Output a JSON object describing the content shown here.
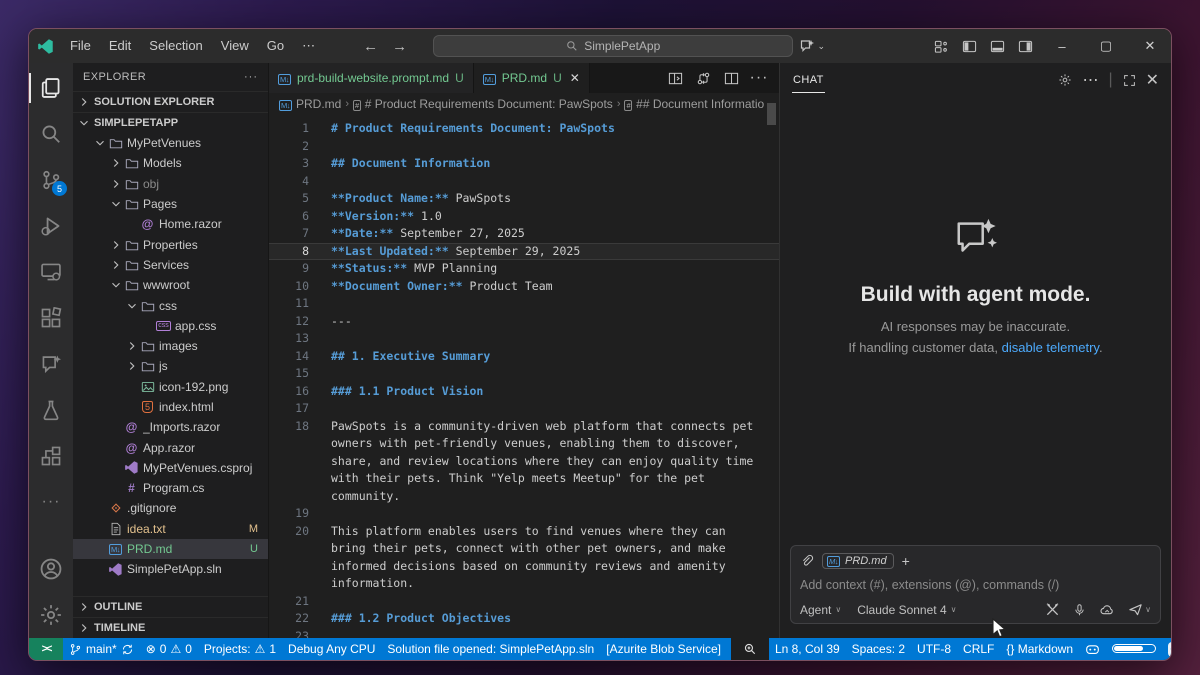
{
  "colors": {
    "statusbar_blue": "#0078d4",
    "remote_green": "#16825d",
    "untracked_green": "#73c991",
    "modified_yellow": "#e2c08d",
    "link_blue": "#4daafc",
    "heading_blue": "#569cd6"
  },
  "titlebar": {
    "menus": [
      "File",
      "Edit",
      "Selection",
      "View",
      "Go",
      "⋯"
    ],
    "search_text": "SimplePetApp"
  },
  "activity_bar": {
    "top": [
      {
        "name": "explorer",
        "active": true
      },
      {
        "name": "search"
      },
      {
        "name": "source-control",
        "badge": "5"
      },
      {
        "name": "run-debug"
      },
      {
        "name": "remote-explorer"
      },
      {
        "name": "extensions"
      },
      {
        "name": "copilot-edits"
      },
      {
        "name": "testing"
      },
      {
        "name": "solution-explorer"
      },
      {
        "name": "more"
      }
    ],
    "bottom": [
      {
        "name": "account"
      },
      {
        "name": "settings"
      }
    ]
  },
  "sidebar": {
    "title": "EXPLORER",
    "tree": [
      {
        "kind": "section",
        "chevron": "right",
        "label": "SOLUTION EXPLORER"
      },
      {
        "kind": "section",
        "chevron": "down",
        "label": "SIMPLEPETAPP"
      },
      {
        "kind": "item",
        "depth": 1,
        "chevron": "down",
        "icon": "folder",
        "label": "MyPetVenues"
      },
      {
        "kind": "item",
        "depth": 2,
        "chevron": "right",
        "icon": "folder",
        "label": "Models"
      },
      {
        "kind": "item",
        "depth": 2,
        "chevron": "right",
        "icon": "folder",
        "label": "obj",
        "dim": true
      },
      {
        "kind": "item",
        "depth": 2,
        "chevron": "down",
        "icon": "folder",
        "label": "Pages"
      },
      {
        "kind": "item",
        "depth": 3,
        "icon": "razor",
        "label": "Home.razor"
      },
      {
        "kind": "item",
        "depth": 2,
        "chevron": "right",
        "icon": "folder",
        "label": "Properties"
      },
      {
        "kind": "item",
        "depth": 2,
        "chevron": "right",
        "icon": "folder",
        "label": "Services"
      },
      {
        "kind": "item",
        "depth": 2,
        "chevron": "down",
        "icon": "folder",
        "label": "wwwroot"
      },
      {
        "kind": "item",
        "depth": 3,
        "chevron": "down",
        "icon": "folder",
        "label": "css"
      },
      {
        "kind": "item",
        "depth": 4,
        "icon": "css",
        "label": "app.css"
      },
      {
        "kind": "item",
        "depth": 3,
        "chevron": "right",
        "icon": "folder",
        "label": "images"
      },
      {
        "kind": "item",
        "depth": 3,
        "chevron": "right",
        "icon": "folder",
        "label": "js"
      },
      {
        "kind": "item",
        "depth": 3,
        "icon": "image",
        "label": "icon-192.png"
      },
      {
        "kind": "item",
        "depth": 3,
        "icon": "html",
        "label": "index.html"
      },
      {
        "kind": "item",
        "depth": 2,
        "icon": "razor",
        "label": "_Imports.razor"
      },
      {
        "kind": "item",
        "depth": 2,
        "icon": "razor",
        "label": "App.razor"
      },
      {
        "kind": "item",
        "depth": 2,
        "icon": "vs",
        "label": "MyPetVenues.csproj"
      },
      {
        "kind": "item",
        "depth": 2,
        "icon": "cs",
        "label": "Program.cs"
      },
      {
        "kind": "item",
        "depth": 1,
        "icon": "git",
        "label": ".gitignore"
      },
      {
        "kind": "item",
        "depth": 1,
        "icon": "txt",
        "label": "idea.txt",
        "color": "modified",
        "badge": "M"
      },
      {
        "kind": "item",
        "depth": 1,
        "icon": "md",
        "label": "PRD.md",
        "color": "untracked",
        "badge": "U",
        "selected": true
      },
      {
        "kind": "item",
        "depth": 1,
        "icon": "vs",
        "label": "SimplePetApp.sln"
      }
    ],
    "bottom_sections": [
      "OUTLINE",
      "TIMELINE"
    ]
  },
  "editor": {
    "tabs": [
      {
        "label": "prd-build-website.prompt.md",
        "badge": "U",
        "icon": "md",
        "active": false
      },
      {
        "label": "PRD.md",
        "badge": "U",
        "icon": "md",
        "active": true,
        "close": true
      }
    ],
    "actions": [
      "open-preview",
      "open-changes",
      "split-editor",
      "more"
    ],
    "breadcrumb": [
      {
        "icon": "md",
        "label": "PRD.md"
      },
      {
        "icon": "sym",
        "label": "# Product Requirements Document: PawSpots"
      },
      {
        "icon": "sym",
        "label": "## Document Informatio"
      }
    ],
    "lines": [
      {
        "n": 1,
        "segs": [
          [
            "h",
            "# Product Requirements Document: PawSpots"
          ]
        ]
      },
      {
        "n": 2,
        "segs": []
      },
      {
        "n": 3,
        "segs": [
          [
            "h",
            "## Document Information"
          ]
        ]
      },
      {
        "n": 4,
        "segs": []
      },
      {
        "n": 5,
        "segs": [
          [
            "b",
            "**Product Name:**"
          ],
          [
            "p",
            " PawSpots"
          ]
        ]
      },
      {
        "n": 6,
        "segs": [
          [
            "b",
            "**Version:**"
          ],
          [
            "p",
            " 1.0"
          ]
        ]
      },
      {
        "n": 7,
        "segs": [
          [
            "b",
            "**Date:**"
          ],
          [
            "p",
            " September 27, 2025"
          ]
        ]
      },
      {
        "n": 8,
        "current": true,
        "segs": [
          [
            "b",
            "**Last Updated:**"
          ],
          [
            "p",
            " September 29, 2025"
          ]
        ]
      },
      {
        "n": 9,
        "segs": [
          [
            "b",
            "**Status:**"
          ],
          [
            "p",
            " MVP Planning"
          ]
        ]
      },
      {
        "n": 10,
        "segs": [
          [
            "b",
            "**Document Owner:**"
          ],
          [
            "p",
            " Product Team"
          ]
        ]
      },
      {
        "n": 11,
        "segs": []
      },
      {
        "n": 12,
        "segs": [
          [
            "p",
            "---"
          ]
        ]
      },
      {
        "n": 13,
        "segs": []
      },
      {
        "n": 14,
        "segs": [
          [
            "h",
            "## 1. Executive Summary"
          ]
        ]
      },
      {
        "n": 15,
        "segs": []
      },
      {
        "n": 16,
        "segs": [
          [
            "h",
            "### 1.1 Product Vision"
          ]
        ]
      },
      {
        "n": 17,
        "segs": []
      },
      {
        "n": 18,
        "segs": [
          [
            "p",
            "PawSpots is a community-driven web platform that connects pet owners with pet-friendly venues, enabling them to discover, share, and review locations where they can enjoy quality time with their pets. Think \"Yelp meets Meetup\" for the pet community."
          ]
        ]
      },
      {
        "n": 19,
        "segs": []
      },
      {
        "n": 20,
        "segs": [
          [
            "p",
            "This platform enables users to find venues where they can bring their pets, connect with other pet owners, and make informed decisions based on community reviews and amenity information."
          ]
        ]
      },
      {
        "n": 21,
        "segs": []
      },
      {
        "n": 22,
        "segs": [
          [
            "h",
            "### 1.2 Product Objectives"
          ]
        ]
      },
      {
        "n": 23,
        "segs": []
      }
    ]
  },
  "chat": {
    "tab_label": "CHAT",
    "title": "Build with agent mode.",
    "subtitle": "AI responses may be inaccurate.",
    "telemetry_prefix": "If handling customer data, ",
    "telemetry_link": "disable telemetry",
    "telemetry_suffix": ".",
    "input": {
      "attachment_chip": "PRD.md",
      "placeholder": "Add context (#), extensions (@), commands (/)",
      "mode": "Agent",
      "model": "Claude Sonnet 4"
    }
  },
  "statusbar": {
    "remote_icon": "><",
    "left": [
      {
        "name": "git-branch",
        "parts": [
          {
            "i": "branch"
          },
          {
            "t": "main*"
          },
          {
            "i": "sync"
          }
        ]
      },
      {
        "name": "problems",
        "parts": [
          {
            "u": "⊗"
          },
          {
            "t": "0"
          },
          {
            "u": "⚠"
          },
          {
            "t": "0"
          }
        ]
      },
      {
        "name": "projects-warning",
        "parts": [
          {
            "t": "Projects:"
          },
          {
            "u": "⚠"
          },
          {
            "t": "1"
          }
        ]
      },
      {
        "name": "debug-config",
        "parts": [
          {
            "t": "Debug Any CPU"
          }
        ]
      },
      {
        "name": "solution-status",
        "parts": [
          {
            "t": "Solution file opened: SimplePetApp.sln"
          }
        ]
      },
      {
        "name": "azurite",
        "parts": [
          {
            "t": "[Azurite Blob Service]"
          }
        ]
      },
      {
        "name": "zoom-indicator",
        "dark": true,
        "parts": [
          {
            "i": "zoom"
          }
        ]
      }
    ],
    "right": [
      {
        "name": "cursor-position",
        "parts": [
          {
            "t": "Ln 8, Col 39"
          }
        ]
      },
      {
        "name": "indentation",
        "parts": [
          {
            "t": "Spaces: 2"
          }
        ]
      },
      {
        "name": "encoding",
        "parts": [
          {
            "t": "UTF-8"
          }
        ]
      },
      {
        "name": "eol",
        "parts": [
          {
            "t": "CRLF"
          }
        ]
      },
      {
        "name": "language-mode",
        "parts": [
          {
            "t": "{} Markdown"
          }
        ]
      },
      {
        "name": "copilot-status",
        "parts": [
          {
            "i": "copilot"
          }
        ]
      },
      {
        "name": "usage-meter",
        "parts": [
          {
            "i": "meter"
          }
        ]
      },
      {
        "name": "csdevkit-badge",
        "parts": [
          {
            "i": "badge"
          }
        ]
      },
      {
        "name": "notifications-bell",
        "parts": [
          {
            "i": "bell"
          }
        ]
      }
    ]
  }
}
